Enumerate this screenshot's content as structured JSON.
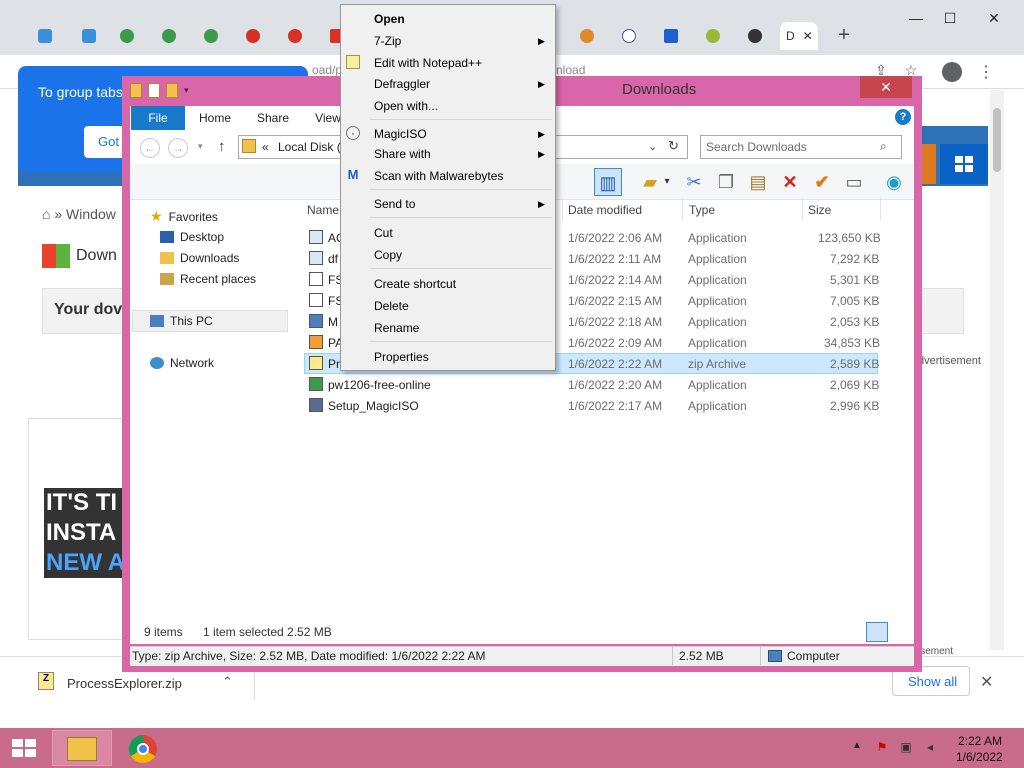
{
  "chrome": {
    "active_tab_text": "D",
    "group_bubble_text": "To group tabs",
    "group_bubble_button": "Got",
    "omnibox_fragment": "oad/p",
    "omnibox_fragment2": "nload",
    "ad_label": "Ad",
    "breadcrumb": "Window",
    "breadcrumb_sep": "»",
    "page_heading": "Down",
    "page_box_text": "Your dov",
    "advertisement": "dvertisement",
    "advertisement2": "isement",
    "ad_lines": [
      "IT'S TI",
      "INSTA",
      "NEW A"
    ],
    "download_name": "ProcessExplorer.zip",
    "show_all": "Show all",
    "close_tab_glyph": "✕",
    "new_tab_glyph": "+"
  },
  "explorer": {
    "title": "Downloads",
    "ribbon_tabs": [
      "File",
      "Home",
      "Share",
      "View"
    ],
    "address_prefix": "«",
    "address_text": "Local Disk (",
    "search_placeholder": "Search Downloads",
    "nav": {
      "favorites": "Favorites",
      "desktop": "Desktop",
      "downloads": "Downloads",
      "recent": "Recent places",
      "thispc": "This PC",
      "network": "Network"
    },
    "columns": {
      "name": "Name",
      "date": "Date modified",
      "type": "Type",
      "size": "Size"
    },
    "files": [
      {
        "name": "AC",
        "date": "1/6/2022 2:06 AM",
        "type": "Application",
        "size": "123,650 KB"
      },
      {
        "name": "df",
        "date": "1/6/2022 2:11 AM",
        "type": "Application",
        "size": "7,292 KB"
      },
      {
        "name": "FS",
        "date": "1/6/2022 2:14 AM",
        "type": "Application",
        "size": "5,301 KB"
      },
      {
        "name": "FS",
        "date": "1/6/2022 2:15 AM",
        "type": "Application",
        "size": "7,005 KB"
      },
      {
        "name": "M",
        "date": "1/6/2022 2:18 AM",
        "type": "Application",
        "size": "2,053 KB"
      },
      {
        "name": "PA",
        "date": "1/6/2022 2:09 AM",
        "type": "Application",
        "size": "34,853 KB"
      },
      {
        "name": "Pr",
        "date": "1/6/2022 2:22 AM",
        "type": "zip Archive",
        "size": "2,589 KB"
      },
      {
        "name": "pw1206-free-online",
        "date": "1/6/2022 2:20 AM",
        "type": "Application",
        "size": "2,069 KB"
      },
      {
        "name": "Setup_MagicISO",
        "date": "1/6/2022 2:17 AM",
        "type": "Application",
        "size": "2,996 KB"
      }
    ],
    "status_items": "9 items",
    "status_selected": "1 item selected  2.52 MB",
    "details_bar": "Type: zip Archive, Size: 2.52 MB, Date modified: 1/6/2022 2:22 AM",
    "details_size": "2.52 MB",
    "details_location": "Computer"
  },
  "context_menu": {
    "open": "Open",
    "zip7": "7-Zip",
    "notepad": "Edit with Notepad++",
    "defraggler": "Defraggler",
    "open_with": "Open with...",
    "magiciso": "MagicISO",
    "share_with": "Share with",
    "malwarebytes": "Scan with Malwarebytes",
    "send_to": "Send to",
    "cut": "Cut",
    "copy": "Copy",
    "create_shortcut": "Create shortcut",
    "delete": "Delete",
    "rename": "Rename",
    "properties": "Properties"
  },
  "taskbar": {
    "time": "2:22 AM",
    "date": "1/6/2022"
  },
  "colors": {
    "explorer_frame": "#d966a8",
    "taskbar": "#c96b8a",
    "ribbon_file": "#1979ca",
    "selection": "#cce8ff",
    "chrome_bubble": "#1a73e8"
  }
}
